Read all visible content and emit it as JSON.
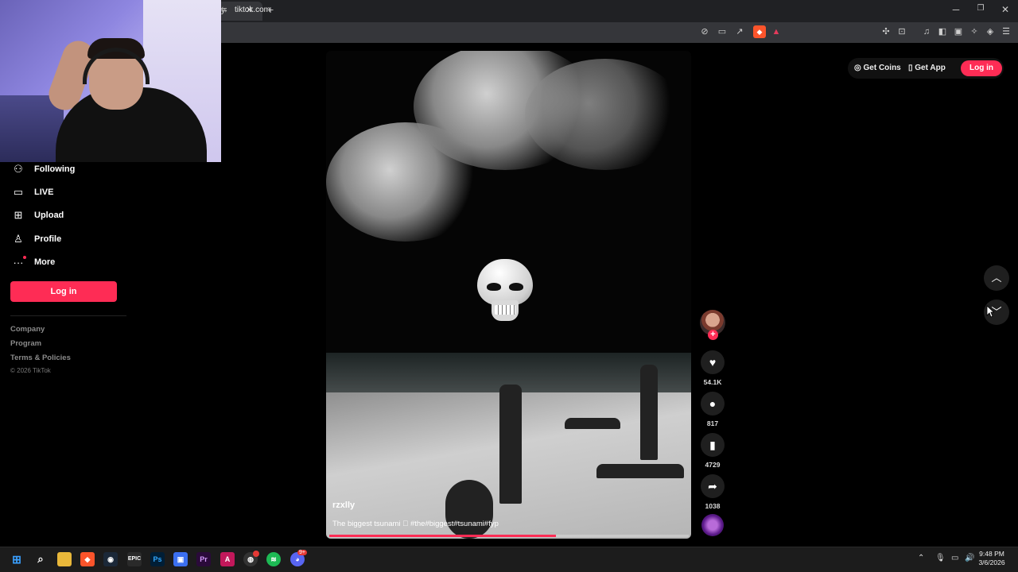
{
  "browser": {
    "tab_title": "y",
    "tab_close_glyph": "✕",
    "new_tab_glyph": "+",
    "url": "tiktok.com",
    "window_controls": {
      "minimize": "─",
      "restore": "❐",
      "close": "✕"
    }
  },
  "sidebar": {
    "items": [
      {
        "label": "Following",
        "icon": "following-icon"
      },
      {
        "label": "LIVE",
        "icon": "live-icon"
      },
      {
        "label": "Upload",
        "icon": "upload-icon"
      },
      {
        "label": "Profile",
        "icon": "profile-icon"
      },
      {
        "label": "More",
        "icon": "more-icon"
      }
    ],
    "login_label": "Log in",
    "footer_links": [
      "Company",
      "Program",
      "Terms & Policies"
    ],
    "copyright": "© 2026 TikTok"
  },
  "header": {
    "get_coins": "Get Coins",
    "get_app": "Get App",
    "login_label": "Log in"
  },
  "video": {
    "author": "rzxlly",
    "caption": "The biggest tsunami 🏻 #the#biggest#tsunami#fyp",
    "progress": 0.63,
    "likes": "54.1K",
    "comments": "817",
    "saves": "4729",
    "shares": "1038"
  },
  "colors": {
    "accent": "#fe2c55",
    "background": "#000000"
  },
  "taskbar": {
    "clock_time": "9:48 PM",
    "clock_date": "3/6/2026",
    "discord_badge": "9+"
  }
}
